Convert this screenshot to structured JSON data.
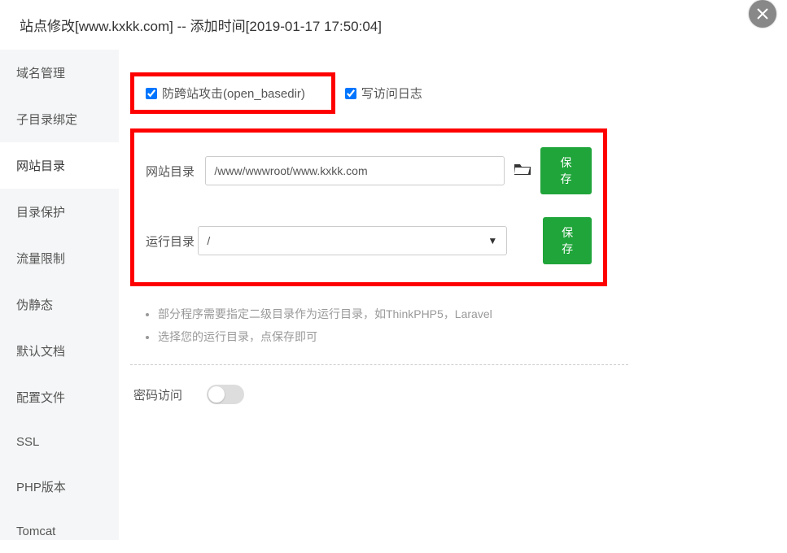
{
  "header": {
    "title": "站点修改[www.kxkk.com] -- 添加时间[2019-01-17 17:50:04]"
  },
  "sidebar": {
    "items": [
      {
        "label": "域名管理"
      },
      {
        "label": "子目录绑定"
      },
      {
        "label": "网站目录"
      },
      {
        "label": "目录保护"
      },
      {
        "label": "流量限制"
      },
      {
        "label": "伪静态"
      },
      {
        "label": "默认文档"
      },
      {
        "label": "配置文件"
      },
      {
        "label": "SSL"
      },
      {
        "label": "PHP版本"
      },
      {
        "label": "Tomcat"
      }
    ],
    "active_index": 2
  },
  "checkboxes": {
    "open_basedir_label": "防跨站攻击(open_basedir)",
    "open_basedir_checked": true,
    "access_log_label": "写访问日志",
    "access_log_checked": true
  },
  "form": {
    "site_dir_label": "网站目录",
    "site_dir_value": "/www/wwwroot/www.kxkk.com",
    "run_dir_label": "运行目录",
    "run_dir_value": "/",
    "save_label": "保存"
  },
  "hints": {
    "items": [
      "部分程序需要指定二级目录作为运行目录，如ThinkPHP5，Laravel",
      "选择您的运行目录，点保存即可"
    ]
  },
  "password_access": {
    "label": "密码访问",
    "enabled": false
  }
}
